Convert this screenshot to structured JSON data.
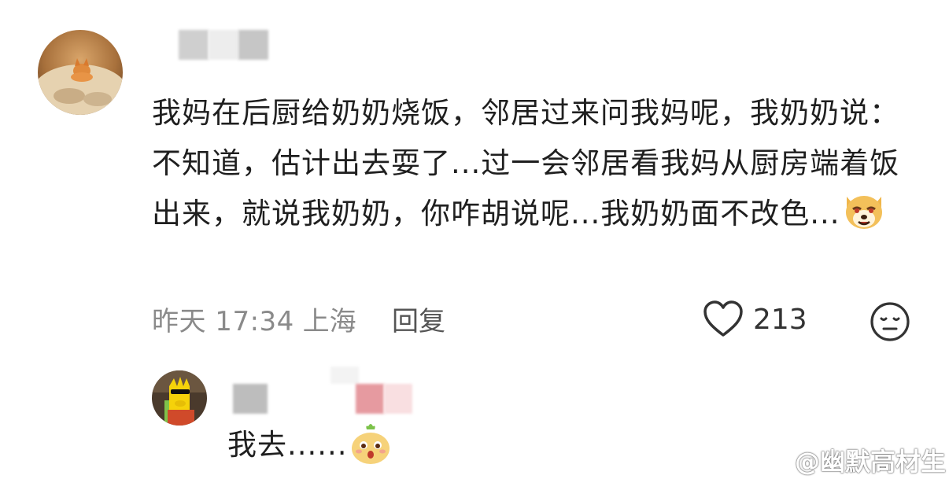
{
  "comment": {
    "text": "我妈在后厨给奶奶烧饭，邻居过来问我妈呢，我奶奶说：不知道，估计出去耍了...过一会邻居看我妈从厨房端着饭出来，就说我奶奶，你咋胡说呢...我奶奶面不改色...",
    "emoji_icon": "smug-dog-emoji",
    "time": "昨天 17:34",
    "location": "上海",
    "reply_label": "回复",
    "like_count": "213",
    "like_icon": "heart-outline-icon",
    "reaction_icon": "meh-face-icon"
  },
  "reply": {
    "text": "我去......",
    "emoji_icon": "surprised-bun-emoji"
  },
  "watermark": {
    "text": "@幽默高材生",
    "icon": "weibo-logo-icon"
  }
}
